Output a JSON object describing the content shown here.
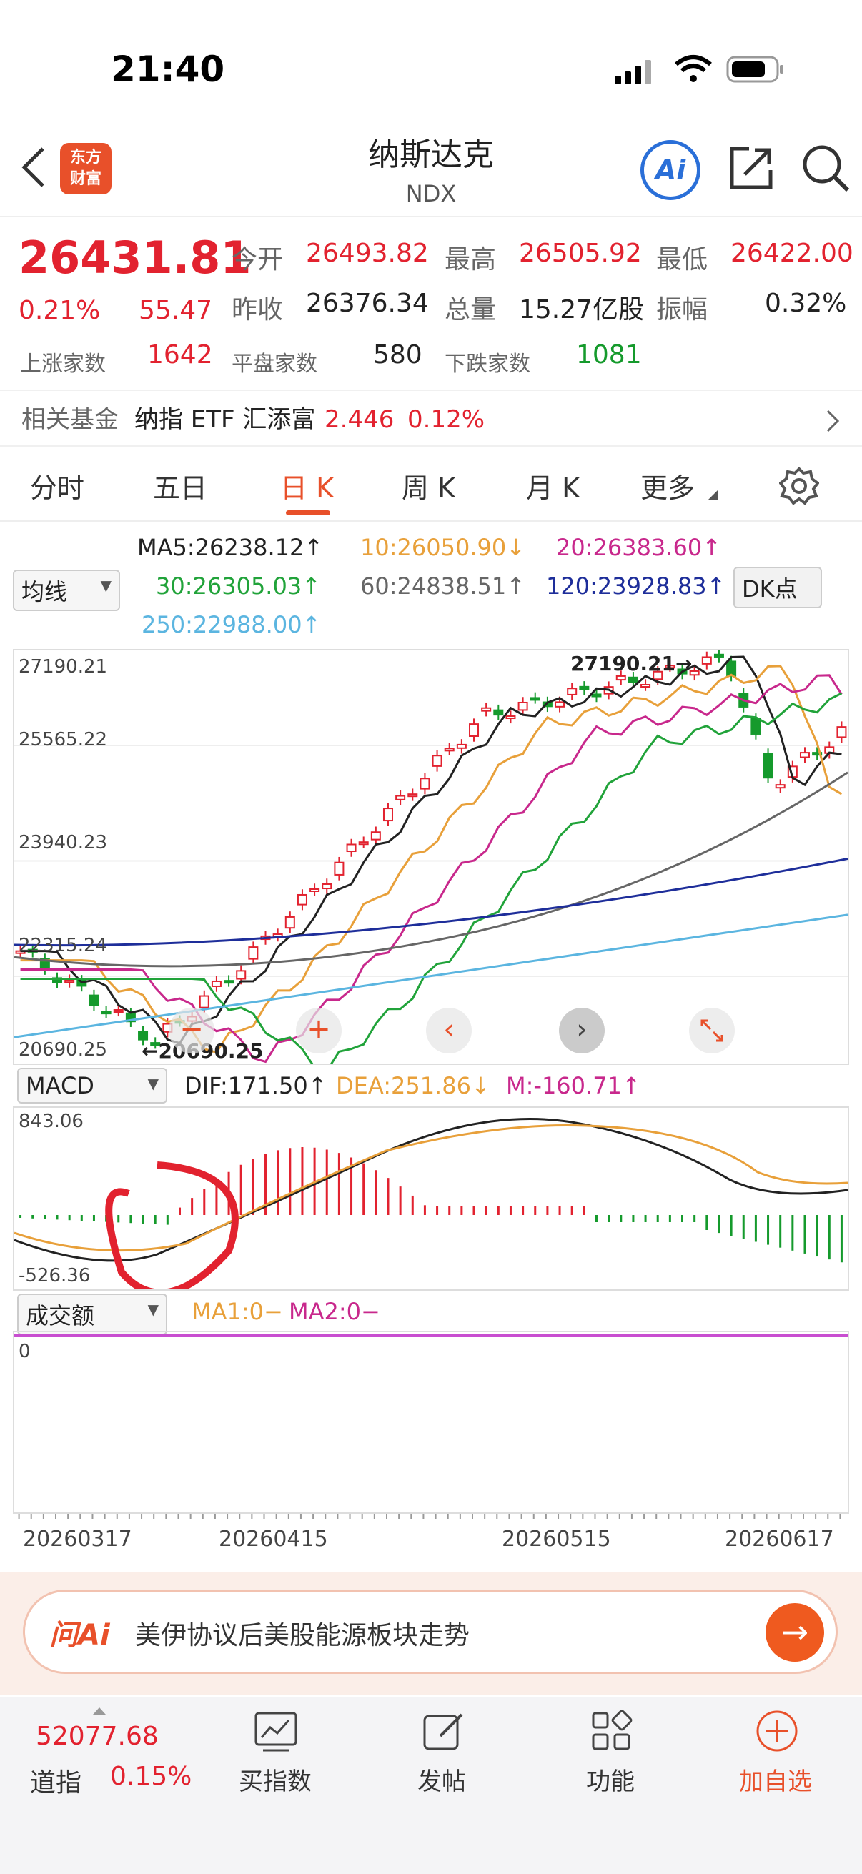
{
  "status": {
    "time": "21:40"
  },
  "nav": {
    "title": "纳斯达克",
    "code": "NDX",
    "logo_text_1": "东方",
    "logo_text_2": "财富",
    "ai_label": "Ai"
  },
  "quote": {
    "price": "26431.81",
    "pct": "0.21%",
    "change": "55.47",
    "open_label": "今开",
    "open": "26493.82",
    "high_label": "最高",
    "high": "26505.92",
    "low_label": "最低",
    "low": "26422.00",
    "prev_label": "昨收",
    "prev": "26376.34",
    "vol_label": "总量",
    "vol": "15.27亿股",
    "amp_label": "振幅",
    "amp": "0.32%",
    "up_label": "上涨家数",
    "up": "1642",
    "flat_label": "平盘家数",
    "flat": "580",
    "down_label": "下跌家数",
    "down": "1081"
  },
  "fund": {
    "label": "相关基金",
    "name": "纳指 ETF 汇添富",
    "price": "2.446",
    "pct": "0.12%"
  },
  "tabs": [
    "分时",
    "五日",
    "日 K",
    "周 K",
    "月 K",
    "更多"
  ],
  "ma": {
    "selector": "均线",
    "ma5": "MA5:26238.12↑",
    "ma10": "10:26050.90↓",
    "ma20": "20:26383.60↑",
    "ma30": "30:26305.03↑",
    "ma60": "60:24838.51↑",
    "ma120": "120:23928.83↑",
    "ma250": "250:22988.00↑",
    "dk": "DK点"
  },
  "kline": {
    "y_labels": [
      "27190.21",
      "25565.22",
      "23940.23",
      "22315.24",
      "20690.25"
    ],
    "high_mark": "27190.21→",
    "low_mark": "←20690.25"
  },
  "macd": {
    "selector": "MACD",
    "dif": "DIF:171.50↑",
    "dea": "DEA:251.86↓",
    "m": "M:-160.71↑",
    "top": "843.06",
    "bottom": "-526.36"
  },
  "volume": {
    "selector": "成交额",
    "ma1": "MA1:0−",
    "ma2": "MA2:0−",
    "zero": "0"
  },
  "dates": [
    "20260317",
    "20260415",
    "20260515",
    "20260617"
  ],
  "ask": {
    "brand": "问Ai",
    "text": "美伊协议后美股能源板块走势"
  },
  "footer": {
    "dji_value": "52077.68",
    "dji_name": "道指",
    "dji_pct": "0.15%",
    "buy": "买指数",
    "post": "发帖",
    "func": "功能",
    "add": "加自选"
  },
  "colors": {
    "red": "#e2222f",
    "green": "#159a2c",
    "ma5": "#222222",
    "ma10": "#e8a03a",
    "ma20": "#c8288c",
    "ma30": "#21a33a",
    "ma60": "#666666",
    "ma120": "#1e2e9a",
    "ma250": "#5bb5e0"
  }
}
